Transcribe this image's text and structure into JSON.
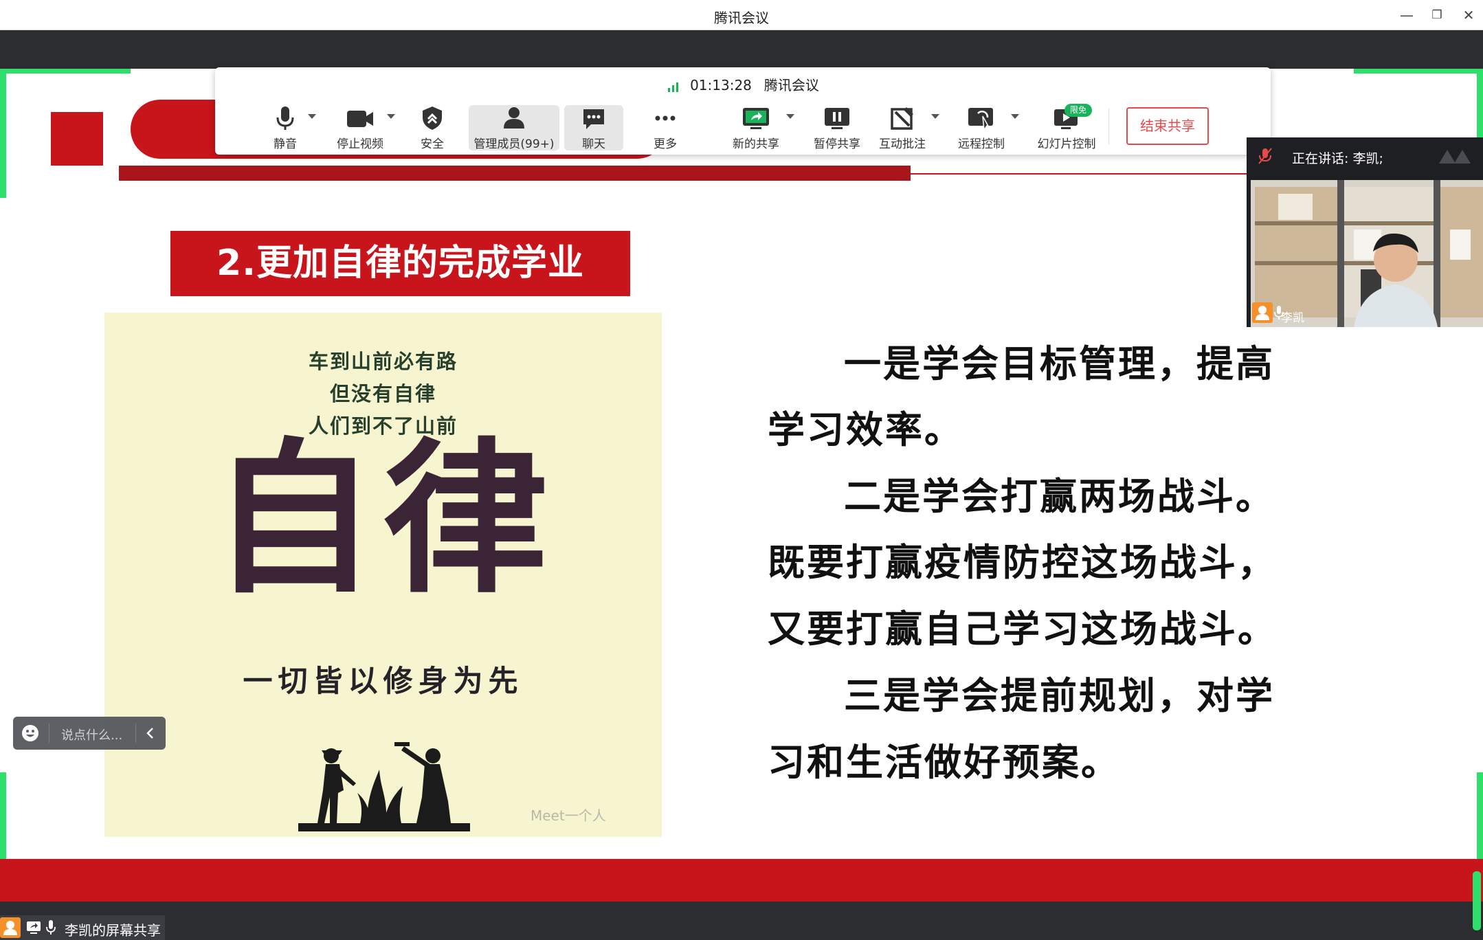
{
  "window": {
    "title": "腾讯会议"
  },
  "toolbar": {
    "timer": "01:13:28",
    "app_name": "腾讯会议",
    "buttons": {
      "mute": "静音",
      "stop_video": "停止视频",
      "security": "安全",
      "manage_members": "管理成员(99+)",
      "chat": "聊天",
      "more": "更多",
      "new_share": "新的共享",
      "pause_share": "暂停共享",
      "annotate": "互动批注",
      "remote_control": "远程控制",
      "slide_control": "幻灯片控制"
    },
    "slide_control_badge": "限免",
    "end_share": "结束共享"
  },
  "speaker": {
    "speaking_label": "正在讲话: 李凯;",
    "name": "李凯"
  },
  "slide": {
    "heading": "2.更加自律的完成学业",
    "poster": {
      "line1": "车到山前必有路",
      "line2": "但没有自律",
      "line3": "人们到不了山前",
      "big_text": "自律",
      "motto": "一切皆以修身为先",
      "watermark": "Meet一个人"
    },
    "lines": [
      "一是学会目标管理，提高",
      "学习效率。",
      "二是学会打赢两场战斗。",
      "既要打赢疫情防控这场战斗，",
      "又要打赢自己学习这场战斗。",
      "三是学会提前规划，对学",
      "习和生活做好预案。"
    ]
  },
  "chat": {
    "placeholder": "说点什么..."
  },
  "bottom": {
    "share_label": "李凯的屏幕共享"
  },
  "colors": {
    "accent_red": "#c8141b",
    "share_green": "#2ee06b",
    "end_share_red": "#e84a4a"
  }
}
